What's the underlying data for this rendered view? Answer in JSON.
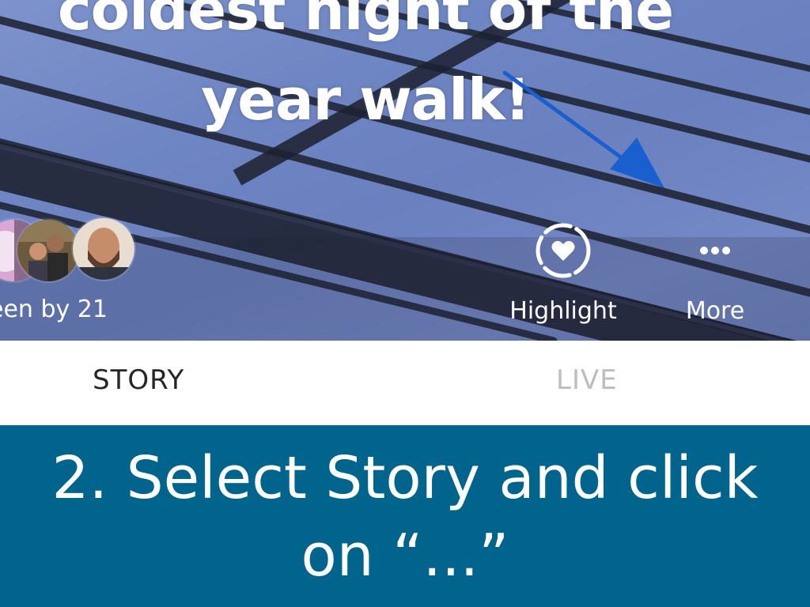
{
  "story": {
    "caption_line1": "coldest night of the",
    "caption_line2": "year walk!",
    "seen_by": "een by 21",
    "highlight_label": "Highlight",
    "more_label": "More",
    "icons": {
      "highlight": "heart-circle-icon",
      "more": "ellipsis-icon",
      "annotation": "arrow-icon"
    },
    "colors": {
      "arrow": "#1a5fd0",
      "photo_tint": "#6f86c4"
    }
  },
  "tabs": [
    {
      "label": "STORY",
      "active": true
    },
    {
      "label": "LIVE",
      "active": false
    }
  ],
  "instruction": {
    "line1": "2. Select Story and click",
    "line2": "on “...”",
    "background": "#00648c"
  }
}
